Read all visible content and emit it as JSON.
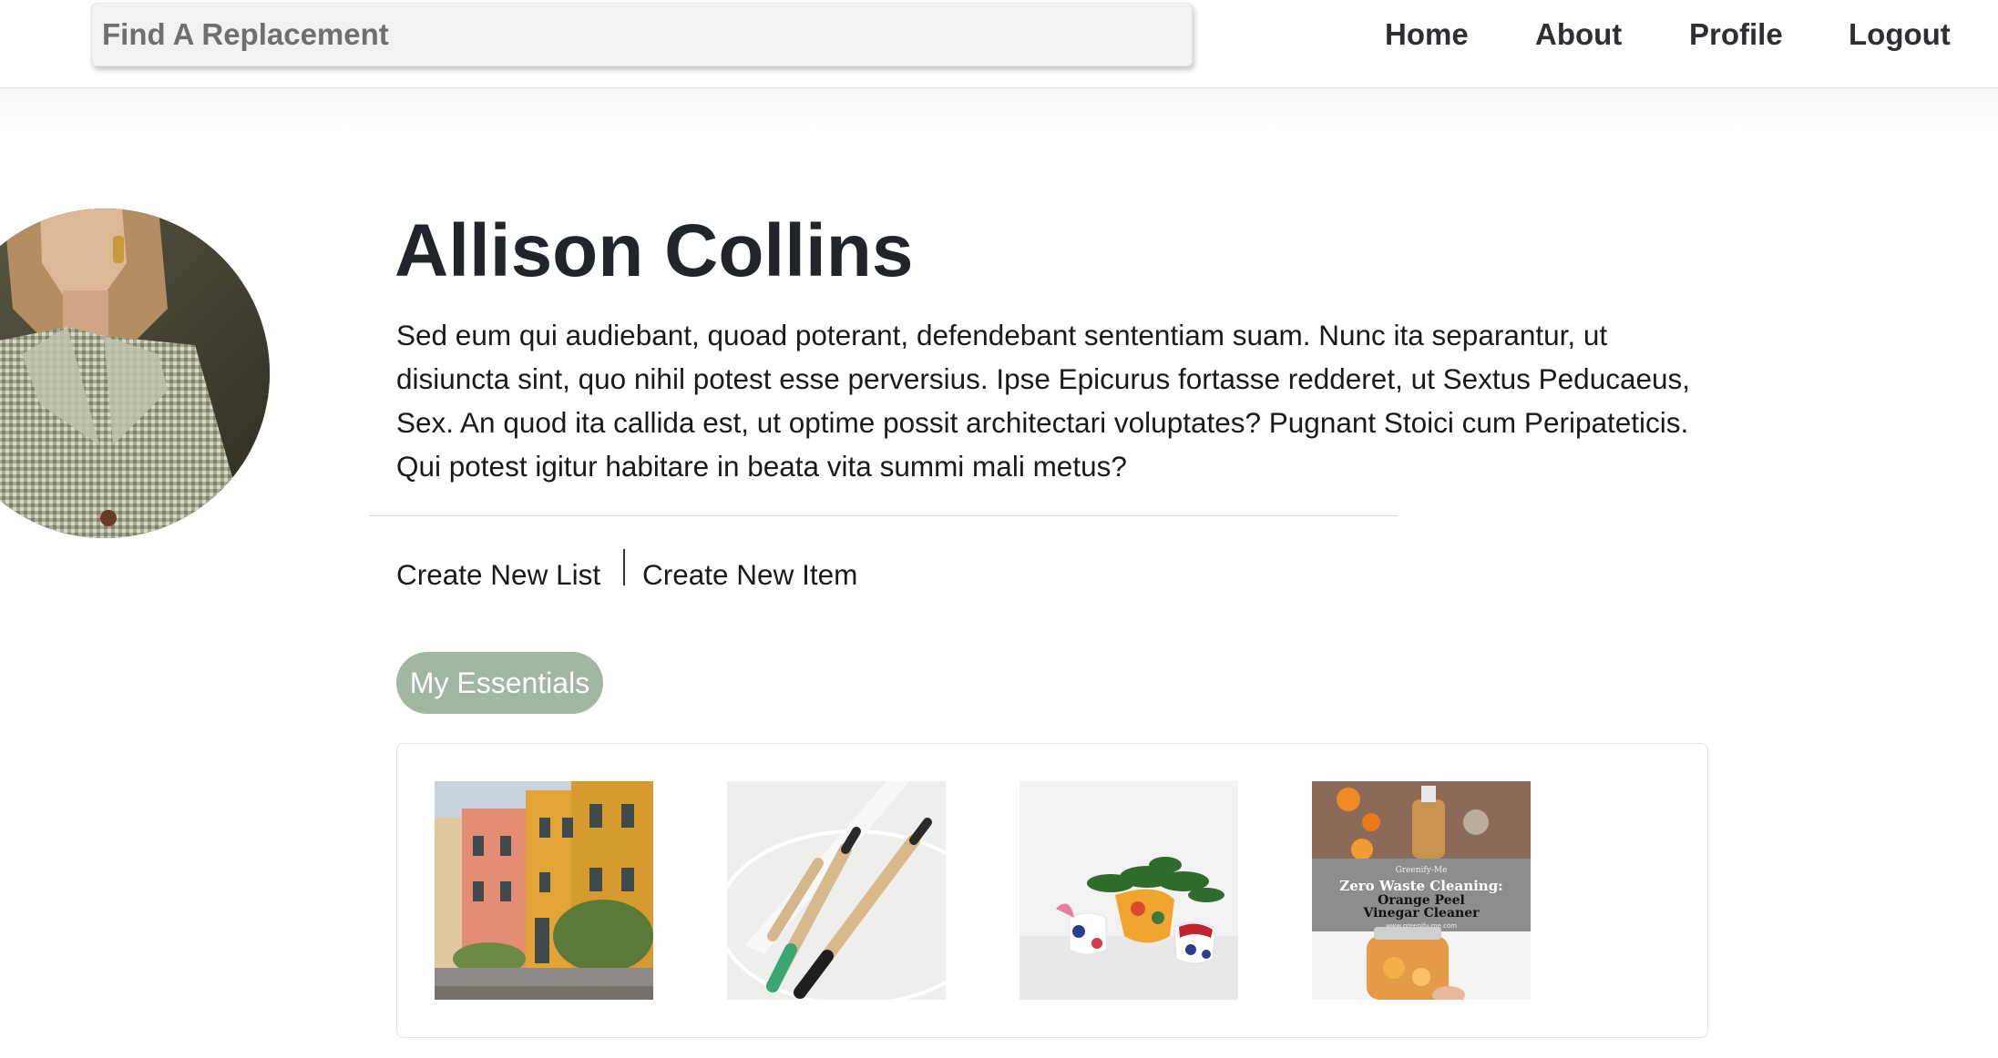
{
  "header": {
    "search": {
      "placeholder": "Find A Replacement"
    },
    "nav": [
      {
        "label": "Home"
      },
      {
        "label": "About"
      },
      {
        "label": "Profile"
      },
      {
        "label": "Logout"
      }
    ]
  },
  "profile": {
    "name": "Allison Collins",
    "bio": "Sed eum qui audiebant, quoad poterant, defendebant sententiam suam. Nunc ita separantur, ut disiuncta sint, quo nihil potest esse perversius. Ipse Epicurus fortasse redderet, ut Sextus Peducaeus, Sex. An quod ita callida est, ut optime possit architectari voluptates? Pugnant Stoici cum Peripateticis. Qui potest igitur habitare in beata vita summi mali metus?"
  },
  "actions": {
    "create_list": "Create New List",
    "create_item": "Create New Item"
  },
  "lists": {
    "active_list": "My Essentials",
    "items": [
      {
        "image": "colorful-houses-street-photo"
      },
      {
        "image": "bamboo-toothbrushes-photo"
      },
      {
        "image": "plants-in-vases-photo"
      },
      {
        "image": "zero-waste-cleaning-pin",
        "brand": "Greenify-Me",
        "title_line1": "Zero Waste Cleaning:",
        "title_line2": "Orange Peel",
        "title_line3": "Vinegar Cleaner",
        "url": "www.greenify-me.com"
      }
    ]
  },
  "colors": {
    "accent": "#a1b7a1",
    "text": "#212529"
  }
}
